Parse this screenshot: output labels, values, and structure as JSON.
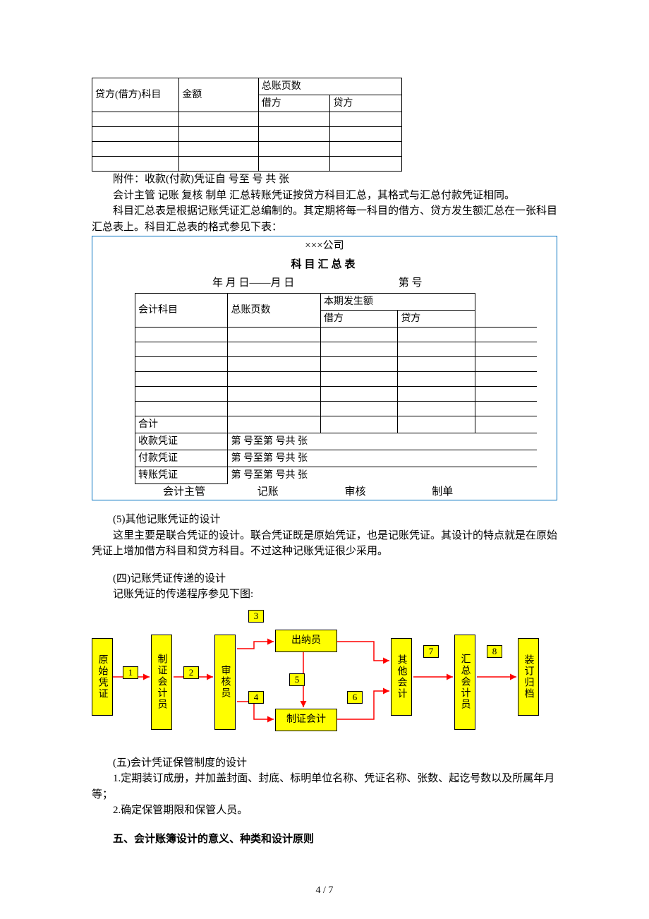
{
  "table1": {
    "col1": "贷方(借方)科目",
    "col2": "金额",
    "col3": "总账页数",
    "col3a": "借方",
    "col3b": "贷方"
  },
  "p1": "附件：收款(付款)凭证自  号至  号  共  张",
  "p2": "会计主管  记账  复核  制单  汇总转账凭证按贷方科目汇总，其格式与汇总付款凭证相同。",
  "p3": "科目汇总表是根据记账凭证汇总编制的。其定期将每一科目的借方、贷方发生额汇总在一张科目汇总表上。科目汇总表的格式参见下表：",
  "blue": {
    "company": "×××公司",
    "title": "科目汇总表",
    "dateline": "年 月 日——月 日",
    "no": "第  号",
    "t2": {
      "col1": "会计科目",
      "col2": "总账页数",
      "col3": "本期发生额",
      "col3a": "借方",
      "col3b": "贷方",
      "sum": "合计",
      "r_sk": "收款凭证",
      "r_fk": "付款凭证",
      "r_zz": "转账凭证",
      "range": "第     号至第     号共     张"
    },
    "sig1": "会计主管",
    "sig2": "记账",
    "sig3": "审核",
    "sig4": "制单"
  },
  "p4_h": "(5)其他记账凭证的设计",
  "p4": "这里主要是联合凭证的设计。联合凭证既是原始凭证，也是记账凭证。其设计的特点就是在原始凭证上增加借方科目和贷方科目。不过这种记账凭证很少采用。",
  "p5_h": "(四)记账凭证传递的设计",
  "p5": "记账凭证的传递程序参见下图:",
  "flow": {
    "n1": "原始凭证",
    "n2": "制证会计员",
    "n3": "审核员",
    "n4": "出纳员",
    "n5": "制证会计",
    "n6": "其他会计",
    "n7": "汇总会计员",
    "n8": "装订归档",
    "num1": "1",
    "num2": "2",
    "num3": "3",
    "num4": "4",
    "num5": "5",
    "num6": "6",
    "num7": "7",
    "num8": "8"
  },
  "p6_h": "(五)会计凭证保管制度的设计",
  "p6a": "1.定期装订成册，并加盖封面、封底、标明单位名称、凭证名称、张数、起讫号数以及所属年月等；",
  "p6b": "2.确定保管期限和保管人员。",
  "h5": "五、会计账簿设计的意义、种类和设计原则",
  "footer": "4 / 7"
}
